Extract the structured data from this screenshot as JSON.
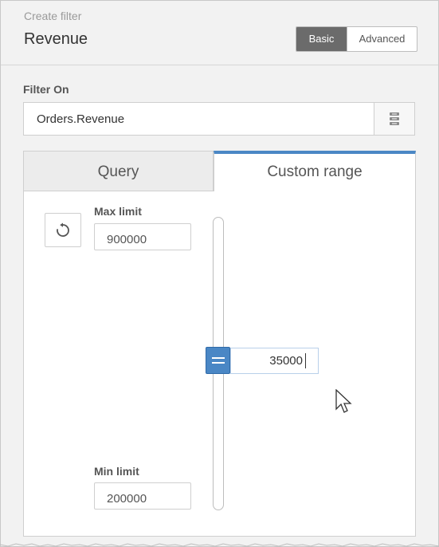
{
  "header": {
    "subtitle": "Create filter",
    "title": "Revenue",
    "mode_options": [
      {
        "label": "Basic",
        "active": true
      },
      {
        "label": "Advanced",
        "active": false
      }
    ]
  },
  "filter_on": {
    "label": "Filter On",
    "value": "Orders.Revenue",
    "browse_icon": "database-icon"
  },
  "tabs": [
    {
      "label": "Query",
      "active": false
    },
    {
      "label": "Custom range",
      "active": true
    }
  ],
  "range": {
    "reset_icon": "reset-icon",
    "max_label": "Max limit",
    "max_value": "900000",
    "min_label": "Min limit",
    "min_value": "200000",
    "handle_value": "35000",
    "handle_icon": "drag-handle-icon"
  },
  "colors": {
    "accent": "#4a87c5",
    "active_toggle": "#6b6b6b"
  }
}
